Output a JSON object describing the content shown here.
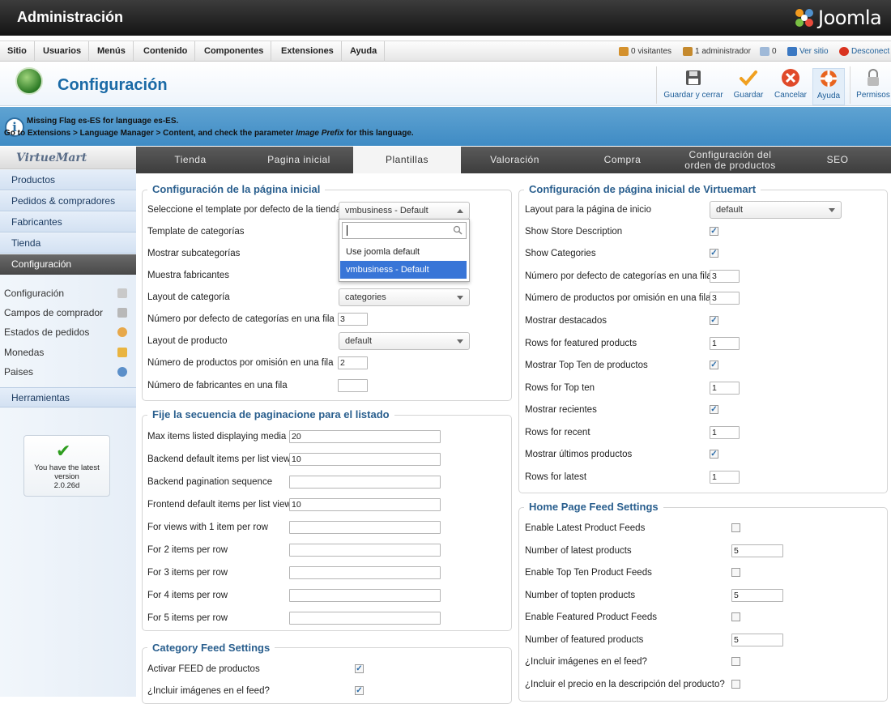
{
  "header": {
    "title": "Administración",
    "logo_text": "Joomla"
  },
  "menu": {
    "items": [
      "Sitio",
      "Usuarios",
      "Menús",
      "Contenido",
      "Componentes",
      "Extensiones",
      "Ayuda"
    ]
  },
  "status": {
    "visitors": "0 visitantes",
    "admins": "1 administrador",
    "messages": "0",
    "view_site": "Ver sitio",
    "logout": "Desconect"
  },
  "toolbar": {
    "title": "Configuración",
    "buttons": [
      "Guardar y cerrar",
      "Guardar",
      "Cancelar",
      "Ayuda",
      "Permisos"
    ]
  },
  "message": {
    "line1": "Missing Flag es-ES for language es-ES.",
    "line2a": "Go to Extensions > Language Manager > Content, and check the parameter ",
    "line2b": "Image Prefix",
    "line2c": " for this language."
  },
  "sidebar": {
    "logo": "VirtueMart",
    "items": [
      "Productos",
      "Pedidos & compradores",
      "Fabricantes",
      "Tienda",
      "Configuración"
    ],
    "subitems": [
      "Configuración",
      "Campos de comprador",
      "Estados de pedidos",
      "Monedas",
      "Paises"
    ],
    "tools": "Herramientas",
    "version_line1": "You have the latest",
    "version_line2": "version",
    "version_number": "2.0.26d"
  },
  "tabs": [
    "Tienda",
    "Pagina inicial",
    "Plantillas",
    "Valoración",
    "Compra",
    "Configuración del orden de productos",
    "SEO"
  ],
  "left": {
    "fs1": {
      "legend": "Configuración de la página inicial",
      "rows": [
        {
          "label": "Seleccione el template por defecto de la tienda",
          "value": "vmbusiness - Default"
        },
        {
          "label": "Template de categorías",
          "value": ""
        },
        {
          "label": "Mostrar subcategorías",
          "value": ""
        },
        {
          "label": "Muestra fabricantes",
          "value": ""
        },
        {
          "label": "Layout de categoría",
          "value": "categories"
        },
        {
          "label": "Número por defecto de categorías en una fila",
          "value": "3"
        },
        {
          "label": "Layout de producto",
          "value": "default"
        },
        {
          "label": "Número de productos por omisión en una fila",
          "value": "2"
        },
        {
          "label": "Número de fabricantes en una fila",
          "value": ""
        }
      ]
    },
    "dropdown": {
      "options": [
        "Use joomla default",
        "vmbusiness - Default"
      ]
    },
    "fs2": {
      "legend": "Fije la secuencia de paginacione para el listado",
      "rows": [
        {
          "label": "Max items listed displaying media",
          "value": "20"
        },
        {
          "label": "Backend default items per list view",
          "value": "10"
        },
        {
          "label": "Backend pagination sequence",
          "value": ""
        },
        {
          "label": "Frontend default items per list view",
          "value": "10"
        },
        {
          "label": "For views with 1 item per row",
          "value": ""
        },
        {
          "label": "For 2 items per row",
          "value": ""
        },
        {
          "label": "For 3 items per row",
          "value": ""
        },
        {
          "label": "For 4 items per row",
          "value": ""
        },
        {
          "label": "For 5 items per row",
          "value": ""
        }
      ]
    },
    "fs3": {
      "legend": "Category Feed Settings",
      "rows": [
        {
          "label": "Activar FEED de productos",
          "checked": true
        },
        {
          "label": "¿Incluir imágenes en el feed?",
          "checked": true
        }
      ]
    }
  },
  "right": {
    "fs1": {
      "legend": "Configuración de página inicial de Virtuemart",
      "rows": [
        {
          "label": "Layout para la página de inicio",
          "value": "default"
        },
        {
          "label": "Show Store Description",
          "checked": true
        },
        {
          "label": "Show Categories",
          "checked": true
        },
        {
          "label": "Número por defecto de categorías en una fila",
          "value": "3"
        },
        {
          "label": "Número de productos por omisión en una fila",
          "value": "3"
        },
        {
          "label": "Mostrar destacados",
          "checked": true
        },
        {
          "label": "Rows for featured products",
          "value": "1"
        },
        {
          "label": "Mostrar Top Ten de productos",
          "checked": true
        },
        {
          "label": "Rows for Top ten",
          "value": "1"
        },
        {
          "label": "Mostrar recientes",
          "checked": true
        },
        {
          "label": "Rows for recent",
          "value": "1"
        },
        {
          "label": "Mostrar últimos productos",
          "checked": true
        },
        {
          "label": "Rows for latest",
          "value": "1"
        }
      ]
    },
    "fs2": {
      "legend": "Home Page Feed Settings",
      "rows": [
        {
          "label": "Enable Latest Product Feeds",
          "checked": false
        },
        {
          "label": "Number of latest products",
          "value": "5"
        },
        {
          "label": "Enable Top Ten Product Feeds",
          "checked": false
        },
        {
          "label": "Number of topten products",
          "value": "5"
        },
        {
          "label": "Enable Featured Product Feeds",
          "checked": false
        },
        {
          "label": "Number of featured products",
          "value": "5"
        },
        {
          "label": "¿Incluir imágenes en el feed?",
          "checked": false
        },
        {
          "label": "¿Incluir el precio en la descripción del producto?",
          "checked": false
        }
      ]
    }
  }
}
